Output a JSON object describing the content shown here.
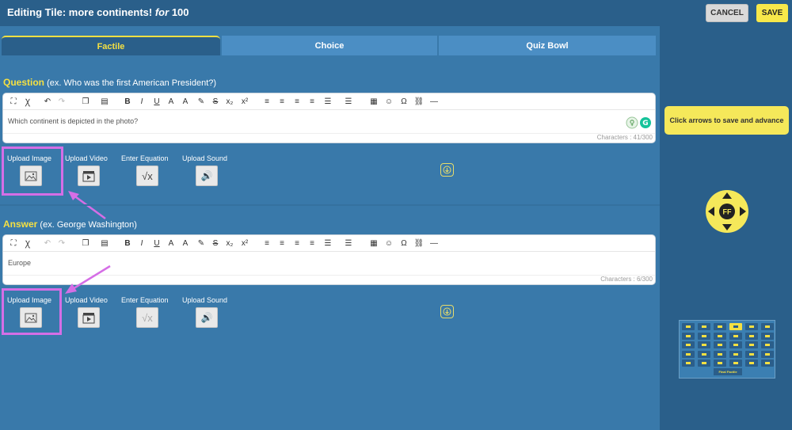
{
  "header": {
    "title_prefix": "Editing Tile: more continents!",
    "title_for": "for",
    "title_points": "100",
    "cancel_label": "CANCEL",
    "save_label": "SAVE"
  },
  "tabs": [
    "Factile",
    "Choice",
    "Quiz Bowl"
  ],
  "question": {
    "label": "Question",
    "hint": "(ex. Who was the first American President?)",
    "text": "Which continent is depicted in the photo?",
    "char_count": "Characters : 41/300"
  },
  "answer": {
    "label": "Answer",
    "hint": "(ex. George Washington)",
    "text": "Europe",
    "char_count": "Characters : 6/300"
  },
  "media": {
    "upload_image": "Upload Image",
    "upload_video": "Upload Video",
    "enter_equation": "Enter Equation",
    "upload_sound": "Upload Sound"
  },
  "side": {
    "hint": "Click arrows to save and advance",
    "nav_label": "FF",
    "mini_board_label": "Final Factile"
  },
  "colors": {
    "accent_yellow": "#f5e042",
    "highlight_pink": "#d56ee6",
    "background_blue": "#3979aa"
  }
}
